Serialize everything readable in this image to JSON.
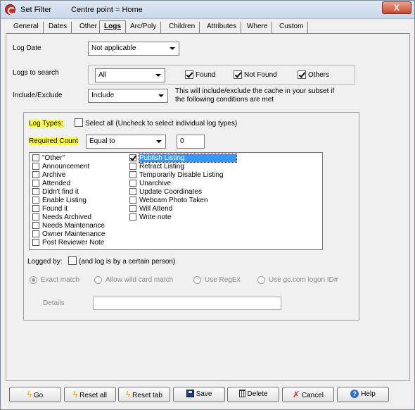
{
  "window": {
    "title": "Set Filter",
    "subtitle": "Centre point = Home",
    "close_label": "X"
  },
  "tabs": [
    "General",
    "Dates",
    "Other",
    "Logs",
    "Arc/Poly",
    "Children",
    "Attributes",
    "Where",
    "Custom"
  ],
  "active_tab": "Logs",
  "log_date": {
    "label": "Log Date",
    "value": "Not applicable"
  },
  "logs_to_search": {
    "label": "Logs to search",
    "value": "All",
    "found_label": "Found",
    "found_checked": true,
    "not_found_label": "Not Found",
    "not_found_checked": true,
    "others_label": "Others",
    "others_checked": true
  },
  "include_exclude": {
    "label": "Include/Exclude",
    "value": "Include",
    "note_line1": "This will include/exclude the cache in your subset if",
    "note_line2": "the following conditions are met"
  },
  "log_types": {
    "label": "Log Types:",
    "select_all_label": "Select all (Uncheck to select individual log types)",
    "select_all_checked": false
  },
  "required_count": {
    "label": "Required Count",
    "operator": "Equal to",
    "value": "0"
  },
  "log_list": {
    "col1": [
      {
        "label": "\"Other\"",
        "checked": false
      },
      {
        "label": "Announcement",
        "checked": false
      },
      {
        "label": "Archive",
        "checked": false
      },
      {
        "label": "Attended",
        "checked": false
      },
      {
        "label": "Didn't find it",
        "checked": false
      },
      {
        "label": "Enable Listing",
        "checked": false
      },
      {
        "label": "Found it",
        "checked": false
      },
      {
        "label": "Needs Archived",
        "checked": false
      },
      {
        "label": "Needs Maintenance",
        "checked": false
      },
      {
        "label": "Owner Maintenance",
        "checked": false
      },
      {
        "label": "Post Reviewer Note",
        "checked": false
      }
    ],
    "col2": [
      {
        "label": "Publish Listing",
        "checked": true,
        "selected": true
      },
      {
        "label": "Retract Listing",
        "checked": false
      },
      {
        "label": "Temporarily Disable Listing",
        "checked": false
      },
      {
        "label": "Unarchive",
        "checked": false
      },
      {
        "label": "Update Coordinates",
        "checked": false
      },
      {
        "label": "Webcam Photo Taken",
        "checked": false
      },
      {
        "label": "Will Attend",
        "checked": false
      },
      {
        "label": "Write note",
        "checked": false
      }
    ]
  },
  "logged_by": {
    "label": "Logged by:",
    "checkbox_label": "(and log is by a certain person)",
    "checked": false,
    "options": [
      "Exact match",
      "Allow wild card match",
      "Use RegEx",
      "Use gc.com logon ID#"
    ],
    "selected_option": "Exact match",
    "details_label": "Details",
    "details_value": ""
  },
  "buttons": [
    "Go",
    "Reset all",
    "Reset tab",
    "Save",
    "Delete",
    "Cancel",
    "Help"
  ],
  "colors": {
    "highlight": "#ffff33",
    "selection": "#3399ff"
  }
}
